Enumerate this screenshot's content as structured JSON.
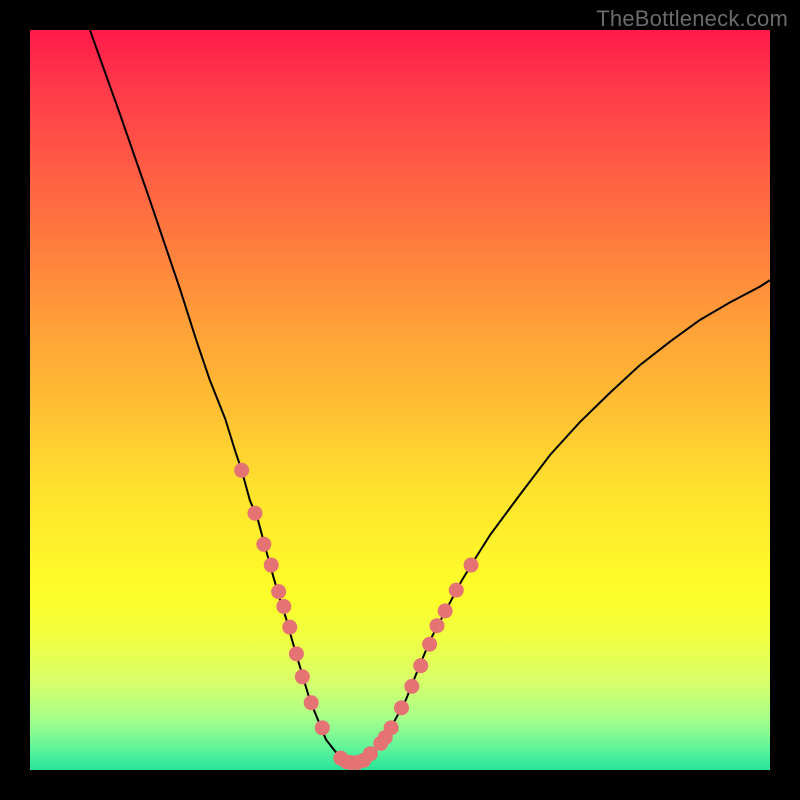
{
  "watermark": "TheBottleneck.com",
  "colors": {
    "curve_stroke": "#000000",
    "dot_fill": "#e57373",
    "gradient_top": "#ff1a4a",
    "gradient_bottom": "#28e49a",
    "frame": "#000000"
  },
  "chart_data": {
    "type": "line",
    "title": "",
    "xlabel": "",
    "ylabel": "",
    "xlim": [
      0,
      100
    ],
    "ylim": [
      0,
      100
    ],
    "grid": false,
    "note": "Values estimated from pixel positions; y=0 at bottom, y=100 at top of the gradient plot area.",
    "series": [
      {
        "name": "curve",
        "x": [
          8.1,
          12.2,
          16.2,
          20.3,
          22.5,
          24.3,
          26.4,
          27.7,
          28.6,
          29.7,
          30.8,
          31.9,
          33.0,
          33.8,
          34.6,
          35.4,
          36.2,
          37.0,
          37.8,
          38.9,
          40.0,
          41.1,
          42.2,
          43.2,
          44.3,
          45.4,
          46.5,
          48.6,
          50.8,
          52.4,
          54.1,
          56.2,
          58.4,
          60.3,
          62.2,
          66.2,
          70.3,
          74.3,
          78.4,
          82.4,
          86.5,
          90.5,
          94.6,
          98.6,
          100.0
        ],
        "y": [
          100.0,
          88.5,
          77.0,
          64.9,
          58.0,
          52.7,
          47.4,
          43.2,
          40.5,
          36.5,
          33.8,
          29.7,
          25.7,
          23.0,
          20.5,
          17.6,
          14.9,
          12.2,
          9.5,
          6.8,
          4.1,
          2.7,
          1.4,
          1.0,
          1.0,
          1.4,
          2.7,
          5.4,
          9.5,
          13.5,
          17.6,
          21.6,
          25.7,
          28.8,
          31.8,
          37.2,
          42.6,
          47.0,
          51.0,
          54.7,
          57.9,
          60.8,
          63.2,
          65.3,
          66.2
        ]
      }
    ],
    "dots": {
      "name": "dots",
      "x": [
        28.6,
        30.4,
        31.6,
        32.6,
        33.6,
        34.3,
        35.1,
        36.0,
        36.8,
        38.0,
        39.5,
        42.0,
        42.8,
        43.4,
        44.2,
        45.1,
        46.0,
        47.4,
        48.0,
        48.8,
        50.2,
        51.6,
        52.8,
        54.0,
        55.0,
        56.1,
        57.6,
        59.6
      ],
      "y": [
        40.5,
        34.7,
        30.5,
        27.7,
        24.1,
        22.1,
        19.3,
        15.7,
        12.6,
        9.1,
        5.7,
        1.6,
        1.1,
        1.0,
        1.0,
        1.3,
        2.2,
        3.6,
        4.4,
        5.7,
        8.4,
        11.3,
        14.1,
        17.0,
        19.5,
        21.5,
        24.3,
        27.7
      ]
    }
  }
}
